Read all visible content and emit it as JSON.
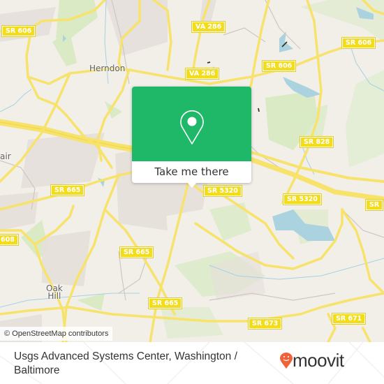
{
  "map": {
    "places": [
      {
        "name": "Herndon"
      },
      {
        "name": "Oak\nHill"
      },
      {
        "name": "air"
      }
    ],
    "route_shields": [
      {
        "label": "SR 606"
      },
      {
        "label": "VA 286"
      },
      {
        "label": "VA 286"
      },
      {
        "label": "SR 606"
      },
      {
        "label": "SR 606"
      },
      {
        "label": "SR 828"
      },
      {
        "label": "SR 665"
      },
      {
        "label": "SR 5320"
      },
      {
        "label": "SR 5320"
      },
      {
        "label": "SR"
      },
      {
        "label": "608"
      },
      {
        "label": "SR 665"
      },
      {
        "label": "SR 665"
      },
      {
        "label": "SR 673"
      },
      {
        "label": "SR 671"
      }
    ],
    "attribution": "© OpenStreetMap contributors"
  },
  "popup": {
    "icon": "map-pin-icon",
    "action_label": "Take me there",
    "accent_color": "#1fb868"
  },
  "footer": {
    "location_title": "Usgs Advanced Systems Center, Washington / Baltimore",
    "brand": "moovit",
    "brand_color": "#f0623a"
  }
}
